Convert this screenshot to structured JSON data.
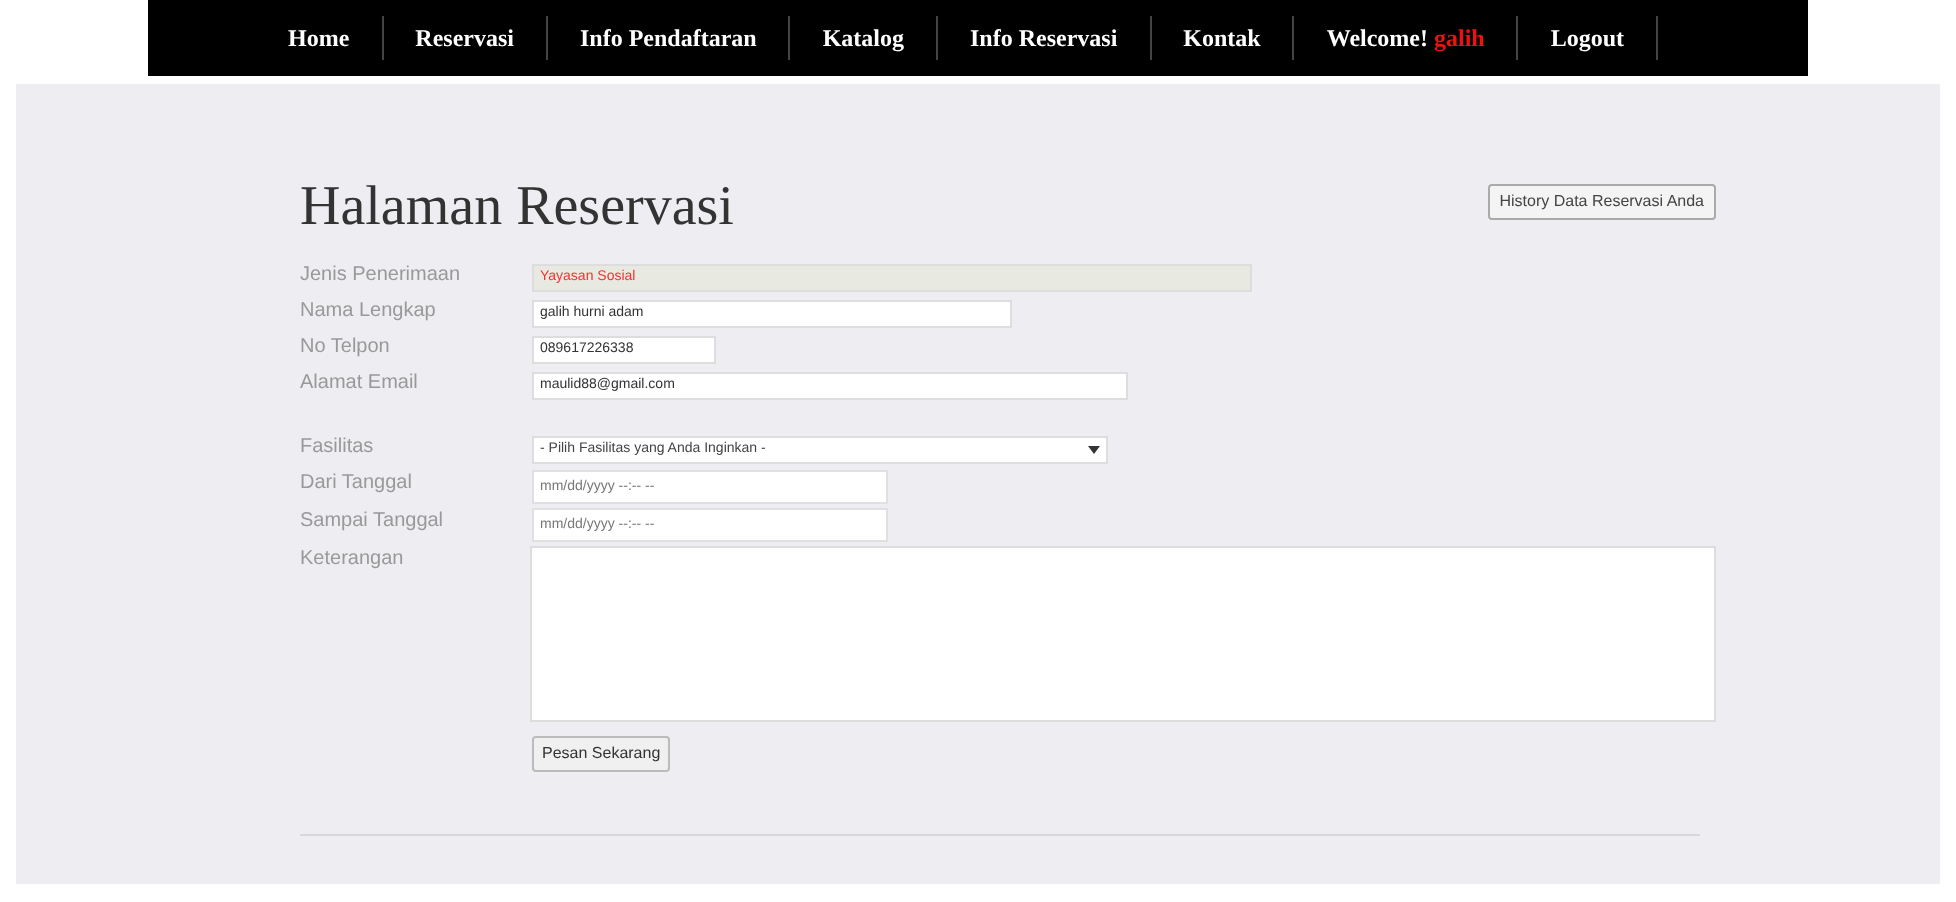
{
  "nav": [
    {
      "label": "Home"
    },
    {
      "label": "Reservasi"
    },
    {
      "label": "Info Pendaftaran"
    },
    {
      "label": "Katalog"
    },
    {
      "label": "Info Reservasi"
    },
    {
      "label": "Kontak"
    },
    {
      "label": "Welcome!",
      "user": "galih"
    },
    {
      "label": "Logout"
    }
  ],
  "title": "Halaman Reservasi",
  "history_button": "History Data Reservasi Anda",
  "fields": [
    {
      "kind": "text",
      "label": "Jenis Penerimaan",
      "value": "Yayasan Sosial",
      "disabled": true
    },
    {
      "kind": "text",
      "label": "Nama Lengkap",
      "value": "galih hurni adam",
      "disabled": false
    },
    {
      "kind": "text",
      "label": "No Telpon",
      "value": "089617226338",
      "disabled": false
    },
    {
      "kind": "text",
      "label": "Alamat Email",
      "value": "maulid88@gmail.com",
      "disabled": false
    },
    {
      "kind": "select",
      "label": "Fasilitas",
      "value": "- Pilih Fasilitas yang Anda Inginkan -"
    },
    {
      "kind": "date",
      "label": "Dari Tanggal",
      "placeholder": "mm/dd/yyyy --:-- --"
    },
    {
      "kind": "date",
      "label": "Sampai Tanggal",
      "placeholder": "mm/dd/yyyy --:-- --"
    },
    {
      "kind": "textarea",
      "label": "Keterangan"
    }
  ],
  "submit": "Pesan Sekarang"
}
